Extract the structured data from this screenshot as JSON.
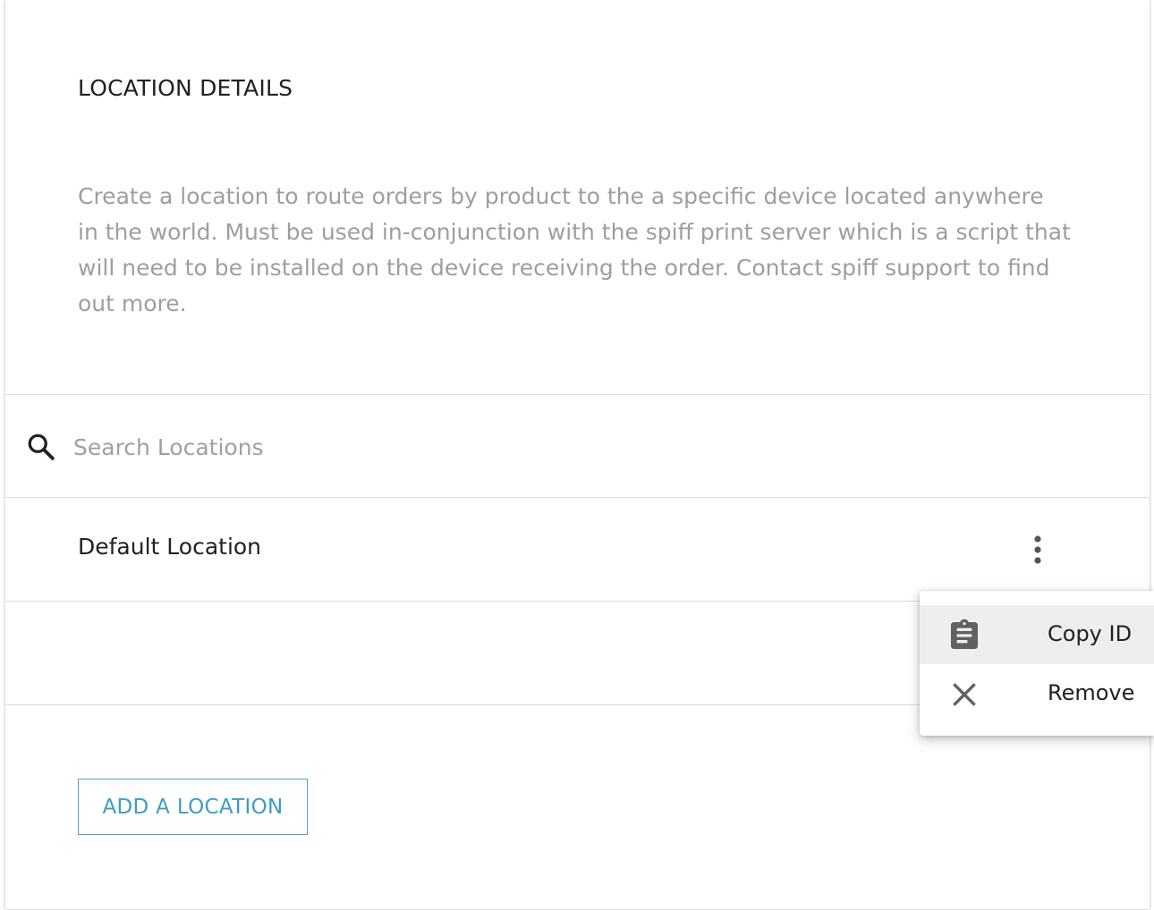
{
  "header": {
    "title": "LOCATION DETAILS",
    "description": "Create a location to route orders by product to the a specific device located anywhere in the world. Must be used in-conjunction with the spiff print server which is a script that will need to be installed on the device receiving the order. Contact spiff support to find out more."
  },
  "search": {
    "placeholder": "Search Locations",
    "value": "",
    "icon": "search-icon"
  },
  "locations": [
    {
      "name": "Default Location",
      "menu_icon": "more-vertical-icon"
    }
  ],
  "add_button": {
    "label": "ADD A LOCATION"
  },
  "context_menu": {
    "items": [
      {
        "label": "Copy ID",
        "icon": "clipboard-icon",
        "highlighted": true
      },
      {
        "label": "Remove",
        "icon": "close-icon",
        "highlighted": false
      }
    ]
  },
  "colors": {
    "accent": "#3c9cc6",
    "text_primary": "#212121",
    "text_secondary": "#9e9e9e",
    "divider": "#dcdcdc",
    "menu_highlight": "#eeeeee"
  }
}
